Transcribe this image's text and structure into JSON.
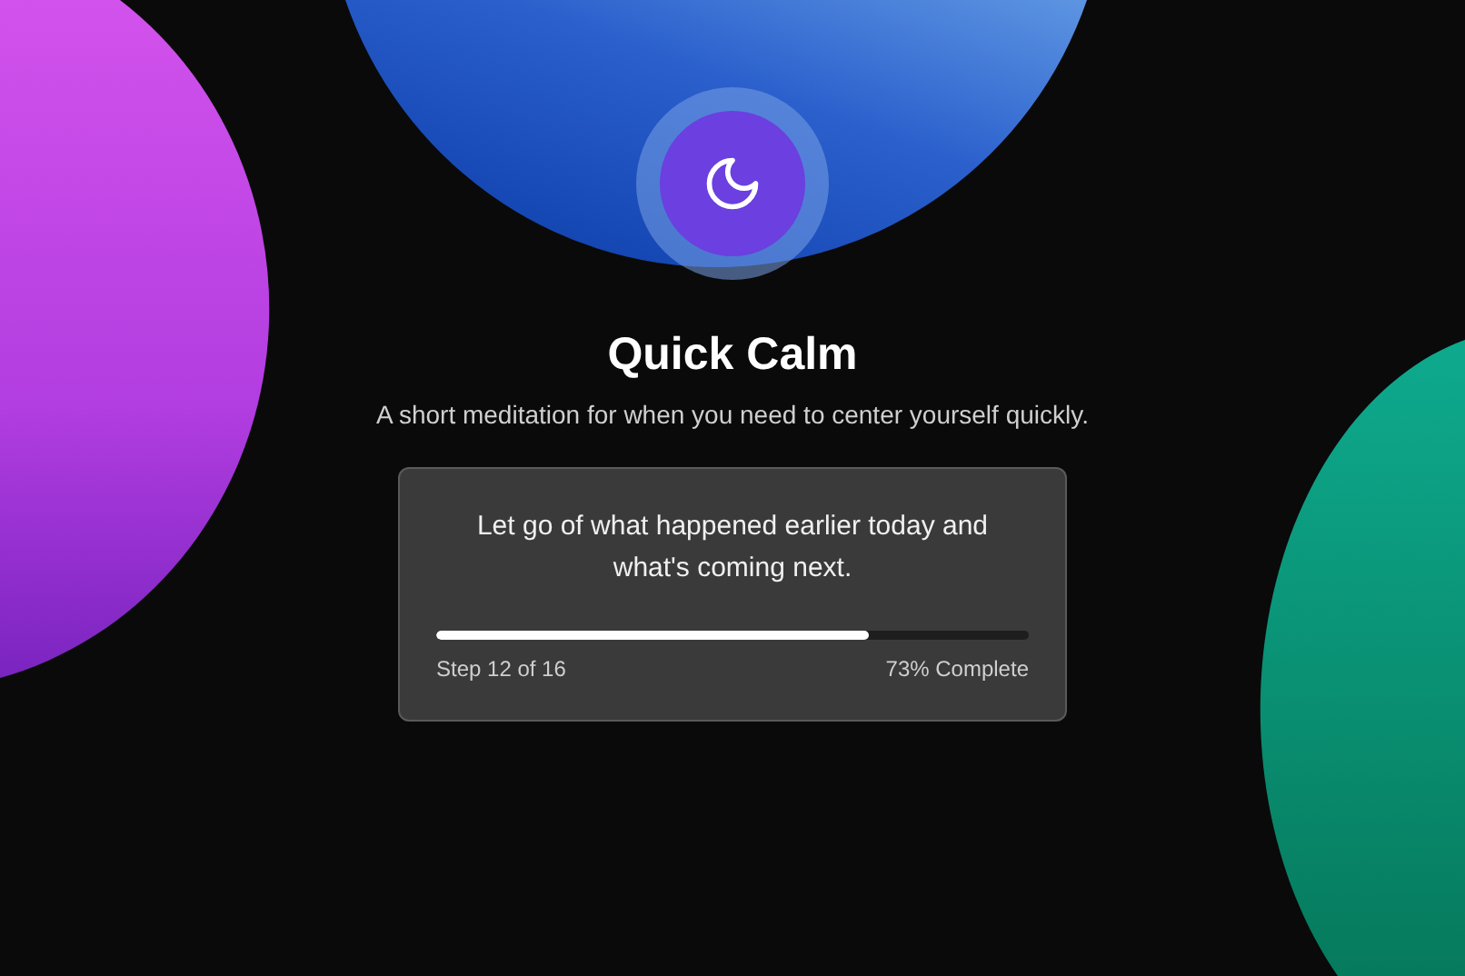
{
  "session": {
    "title": "Quick Calm",
    "subtitle": "A short meditation for when you need to center yourself quickly."
  },
  "step_card": {
    "prompt": "Let go of what happened earlier today and what's coming next.",
    "progress": {
      "level": 0.73
    },
    "step_label": "Step 12 of 16",
    "percent_label": "73% Complete"
  }
}
